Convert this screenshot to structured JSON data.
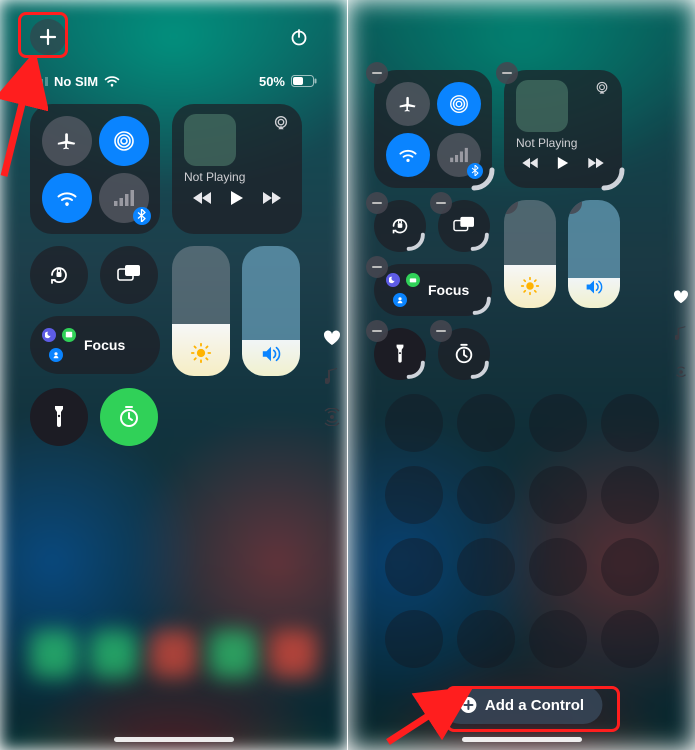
{
  "status": {
    "carrier": "No SIM",
    "battery_pct": "50%"
  },
  "media": {
    "not_playing": "Not Playing"
  },
  "focus": {
    "label": "Focus"
  },
  "add_control": {
    "label": "Add a Control"
  },
  "icons": {
    "plus": "plus",
    "power": "power",
    "airplane": "airplane",
    "airdrop": "airdrop",
    "wifi": "wifi",
    "cellular": "cellular",
    "bluetooth": "bluetooth",
    "airplay": "airplay",
    "rewind": "rewind",
    "play": "play",
    "forward": "forward",
    "orientation_lock": "orientation-lock",
    "screen_mirroring": "screen-mirroring",
    "moon": "moon",
    "bed": "bed",
    "person": "person",
    "brightness": "brightness",
    "volume": "volume",
    "heart": "heart",
    "music_note": "music-note",
    "hotspot": "hotspot",
    "flashlight": "flashlight",
    "timer": "timer"
  },
  "colors": {
    "accent_blue": "#0a84ff",
    "highlight_red": "#ff1e1e",
    "green": "#30d158"
  }
}
